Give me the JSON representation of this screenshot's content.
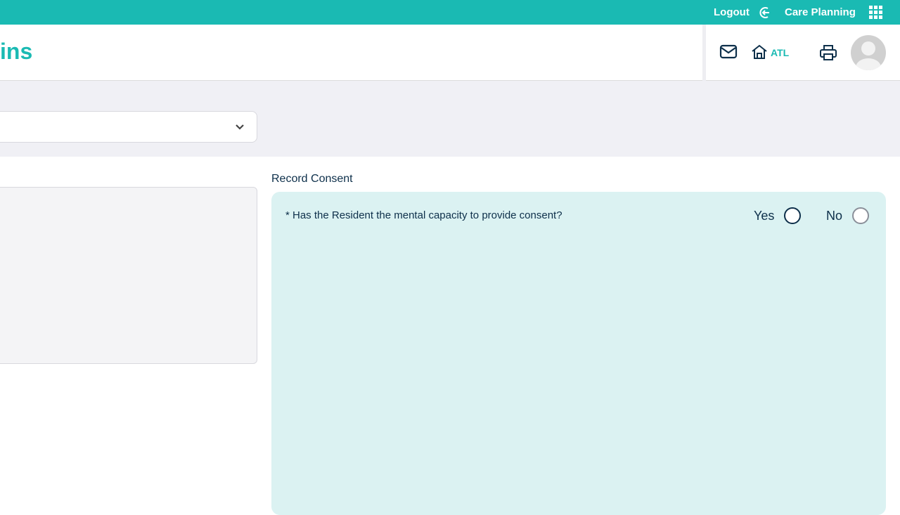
{
  "topbar": {
    "logout": "Logout",
    "app_name": "Care Planning"
  },
  "header": {
    "title": "ins",
    "location": "ATL"
  },
  "form": {
    "section_label": "Record Consent",
    "question": "* Has the Resident the mental capacity to provide consent?",
    "options": [
      {
        "label": "Yes",
        "selected": false
      },
      {
        "label": "No",
        "selected": false
      }
    ]
  }
}
